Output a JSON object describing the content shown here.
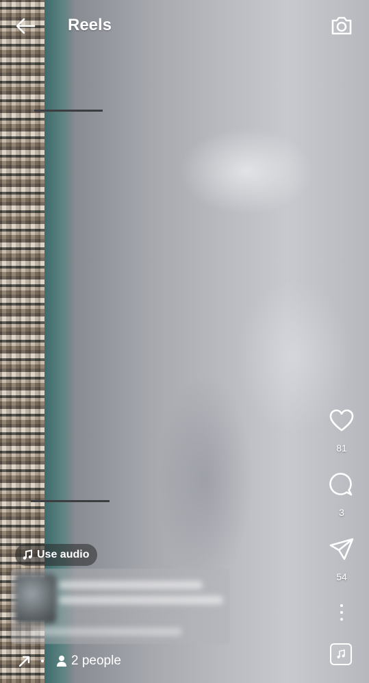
{
  "header": {
    "title": "Reels",
    "back_icon": "back-arrow-icon",
    "camera_icon": "camera-icon"
  },
  "actions": {
    "likes": "81",
    "comments": "3",
    "shares": "54"
  },
  "audio": {
    "use_audio_label": "Use audio"
  },
  "footer": {
    "people_label": "2 people"
  }
}
